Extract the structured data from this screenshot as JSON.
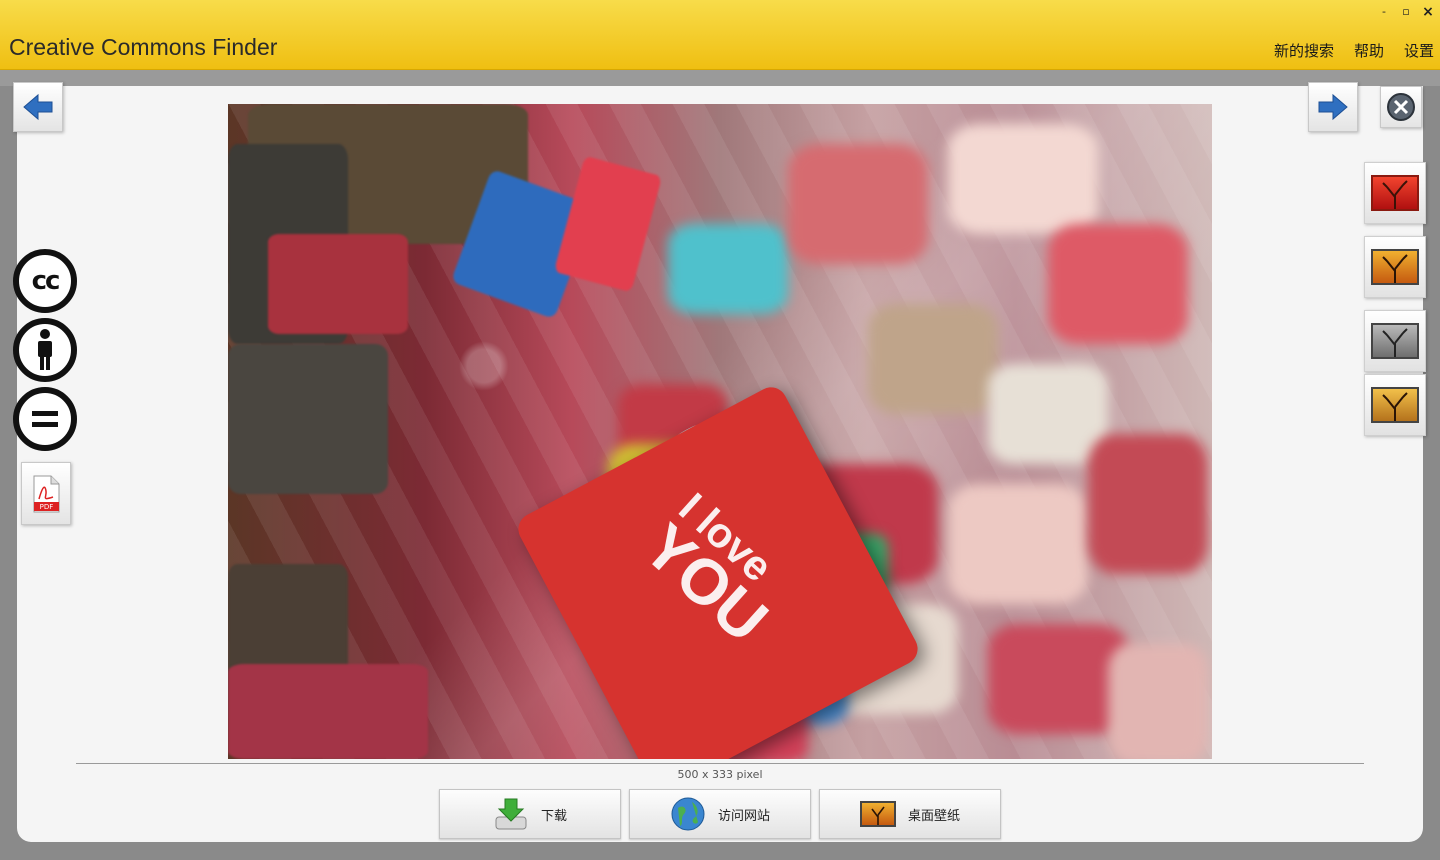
{
  "window": {
    "title": "Creative Commons Finder",
    "controls": {
      "minimize": "-",
      "restore": "▫",
      "close": "×"
    }
  },
  "menu": [
    {
      "label": "新的搜索"
    },
    {
      "label": "帮助"
    },
    {
      "label": "设置"
    }
  ],
  "image": {
    "lock_text_1": "I love",
    "lock_text_2": "YOU",
    "dimensions": "500 x 333 pixel"
  },
  "license_icons": [
    "cc-icon",
    "by-attribution-icon",
    "no-derivatives-icon"
  ],
  "pdf_label": "PDF",
  "actions": [
    {
      "label": "下载",
      "icon": "download-icon"
    },
    {
      "label": "访问网站",
      "icon": "globe-icon"
    },
    {
      "label": "桌面壁纸",
      "icon": "wallpaper-icon"
    }
  ],
  "colors": {
    "titlebar": "#f2c724",
    "arrow": "#2f6fc0",
    "lock_red": "#d6332f"
  }
}
